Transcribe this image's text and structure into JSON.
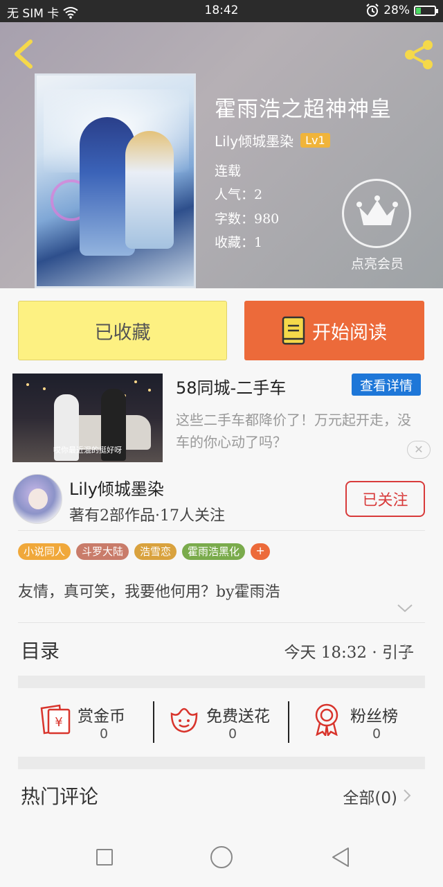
{
  "status_bar": {
    "carrier": "无 SIM 卡",
    "time": "18:42",
    "battery": "28%",
    "battery_level": 0.28,
    "icons": [
      "wifi-icon",
      "alarm-icon",
      "battery-charging-icon"
    ]
  },
  "book": {
    "title": "霍雨浩之超神神皇",
    "author": "Lily倾城墨染",
    "level": "Lv1",
    "status": "连载",
    "popularity": "人气：2",
    "word_count": "字数：980",
    "favorites": "收藏：1",
    "vip_label": "点亮会员"
  },
  "actions": {
    "collected_label": "已收藏",
    "read_label": "开始阅读"
  },
  "ad": {
    "title": "58同城-二手车",
    "button_label": "查看详情",
    "description": "这些二手车都降价了！万元起开走，没车的你心动了吗？",
    "image_caption": "哎你最近混的挺好呀",
    "close_symbol": "✕"
  },
  "author_card": {
    "name": "Lily倾城墨染",
    "stats": "著有2部作品·17人关注",
    "follow_label": "已关注"
  },
  "tags": [
    {
      "label": "小说同人",
      "color": "#f0a83a"
    },
    {
      "label": "斗罗大陆",
      "color": "#c97c6a"
    },
    {
      "label": "浩雪恋",
      "color": "#d9a23e"
    },
    {
      "label": "霍雨浩黑化",
      "color": "#7aab4c"
    }
  ],
  "tag_add": "+",
  "intro": "友情，真可笑，我要他何用？by霍雨浩",
  "catalog": {
    "label": "目录",
    "latest": "今天 18:32 · 引子"
  },
  "rewards": [
    {
      "label": "赏金币",
      "count": "0",
      "icon": "red-envelope-yen-icon"
    },
    {
      "label": "免费送花",
      "count": "0",
      "icon": "flower-smile-icon"
    },
    {
      "label": "粉丝榜",
      "count": "0",
      "icon": "award-ribbon-icon"
    }
  ],
  "comments": {
    "label": "热门评论",
    "all_label": "全部(0)"
  },
  "colors": {
    "accent_orange": "#ec6a3a",
    "collected_yellow": "#fdf182",
    "follow_red": "#d83a3a",
    "ad_blue": "#1e77d8",
    "level_gold": "#f0b43a"
  }
}
